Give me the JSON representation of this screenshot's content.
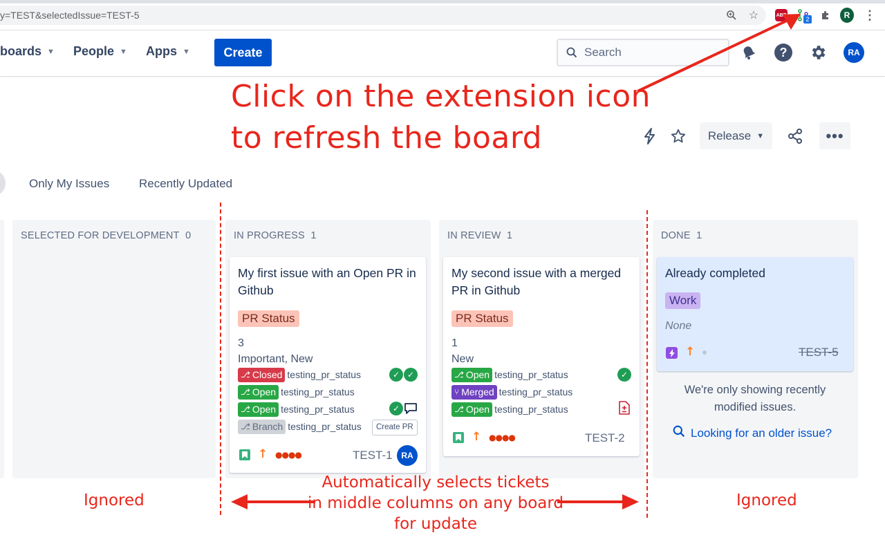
{
  "browser": {
    "url": "y=TEST&selectedIssue=TEST-5",
    "profile_initial": "R",
    "extension_badge": "2",
    "adblock_label": "ABP"
  },
  "nav": {
    "items": [
      {
        "label": "boards"
      },
      {
        "label": "People"
      },
      {
        "label": "Apps"
      }
    ],
    "create_label": "Create",
    "search_placeholder": "Search",
    "avatar_initials": "RA"
  },
  "annotation": {
    "line1": "Click on the extension icon",
    "line2": "to refresh the board",
    "color": "#e8261c"
  },
  "board_header": {
    "release_label": "Release",
    "more_label": "•••"
  },
  "quick_filters": [
    "Only My Issues",
    "Recently Updated"
  ],
  "columns": [
    {
      "title": "SELECTED FOR DEVELOPMENT",
      "count": "0"
    },
    {
      "title": "IN PROGRESS",
      "count": "1"
    },
    {
      "title": "IN REVIEW",
      "count": "1"
    },
    {
      "title": "DONE",
      "count": "1"
    }
  ],
  "cards": {
    "c1": {
      "title": "My first issue with an Open PR in Github",
      "label": "PR Status",
      "count": "3",
      "tags": "Important, New",
      "prs": [
        {
          "status": "Closed",
          "name": "testing_pr_status",
          "color": "#d73a49"
        },
        {
          "status": "Open",
          "name": "testing_pr_status",
          "color": "#28a745"
        },
        {
          "status": "Open",
          "name": "testing_pr_status",
          "color": "#28a745"
        },
        {
          "status": "Branch",
          "name": "testing_pr_status",
          "color": "#cfd2d6"
        }
      ],
      "create_pr_label": "Create PR",
      "key": "TEST-1",
      "assignee": "RA",
      "priority": "↑",
      "dots": "●●●●"
    },
    "c2": {
      "title": "My second issue with a merged PR in Github",
      "label": "PR Status",
      "count": "1",
      "tags": "New",
      "prs": [
        {
          "status": "Open",
          "name": "testing_pr_status",
          "color": "#28a745"
        },
        {
          "status": "Merged",
          "name": "testing_pr_status",
          "color": "#6f42c1"
        },
        {
          "status": "Open",
          "name": "testing_pr_status",
          "color": "#28a745"
        }
      ],
      "key": "TEST-2",
      "priority": "↑",
      "dots": "●●●●"
    },
    "c3": {
      "title": "Already completed",
      "label": "Work",
      "field": "None",
      "key": "TEST-5",
      "priority": "↑"
    }
  },
  "done_footer": {
    "note": "We're only showing recently modified issues.",
    "older_link": "Looking for an older issue?"
  },
  "bottom_annotations": {
    "ignored_left": "Ignored",
    "ignored_right": "Ignored",
    "middle_line1": "Automatically selects tickets",
    "middle_line2": "in middle columns on any board",
    "middle_line3": "for update"
  }
}
